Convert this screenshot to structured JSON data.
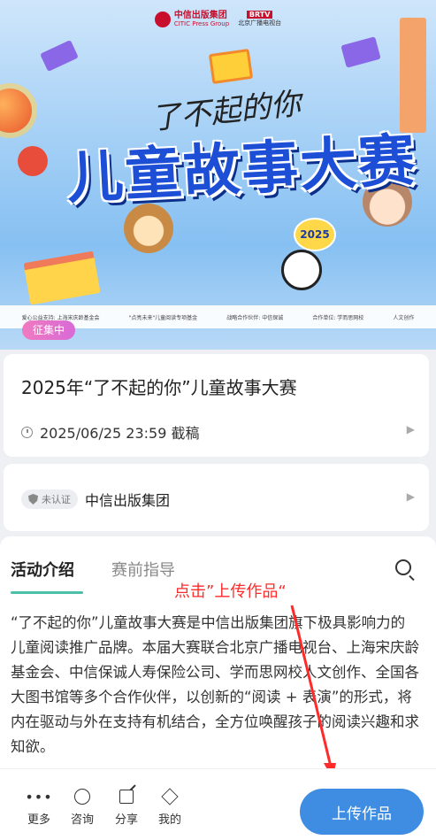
{
  "banner": {
    "publisher": "中信出版集团",
    "publisher_en": "CITIC Press Group",
    "partner_logo": "BRTV",
    "partner_sub": "北京广播电视台",
    "headline_script": "了不起的你",
    "headline": "儿童故事大赛",
    "year_badge": "2025",
    "sponsors": [
      "爱心公益支持: 上海宋庆龄基金会",
      "\"点亮未来\"儿童阅读专项基金",
      "战略合作伙伴: 中信保诚",
      "合作单位: 学而思网校",
      "人文创作"
    ],
    "status_tag": "征集中"
  },
  "event": {
    "title": "2025年“了不起的你”儿童故事大赛",
    "deadline": "2025/06/25 23:59 截稿"
  },
  "organizer": {
    "verify": "未认证",
    "name": "中信出版集团"
  },
  "tabs": {
    "active": "活动介绍",
    "inactive": "赛前指导"
  },
  "annotation": "点击”上传作品“",
  "intro": "“了不起的你”儿童故事大赛是中信出版集团旗下极具影响力的儿童阅读推广品牌。本届大赛联合北京广播电视台、上海宋庆龄基金会、中信保诚人寿保险公司、学而思网校人文创作、全国各大图书馆等多个合作伙伴，以创新的“阅读 + 表演”的形式，将内在驱动与外在支持有机结合，全方位唤醒孩子的阅读兴趣和求知欲。",
  "bottom_nav": {
    "more": "更多",
    "consult": "咨询",
    "share": "分享",
    "mine": "我的",
    "upload": "上传作品"
  },
  "colors": {
    "accent_blue": "#3e8de3",
    "tab_underline": "#4dbfa8",
    "annotation_red": "#ff2a2a",
    "status_tag": "#e678c8"
  }
}
